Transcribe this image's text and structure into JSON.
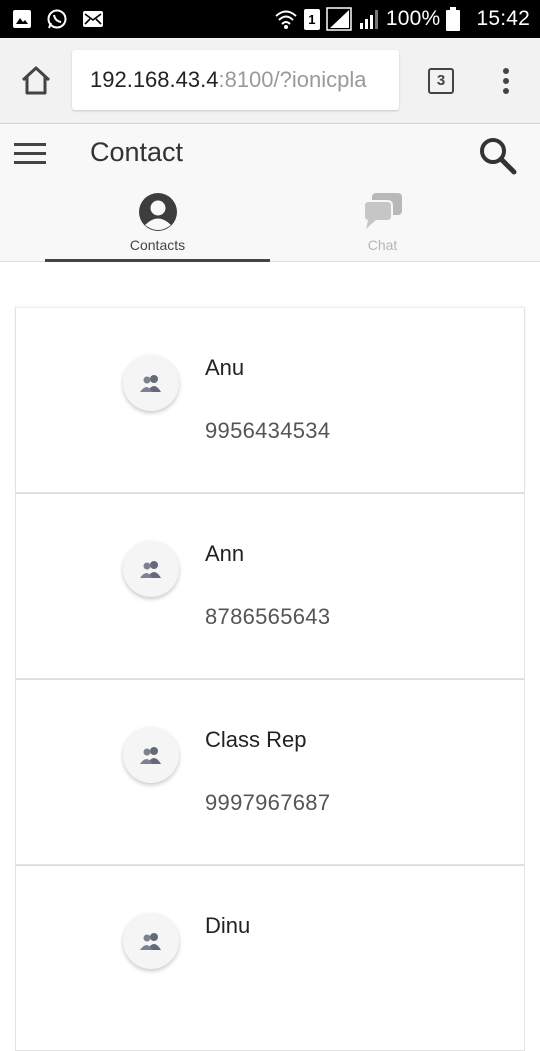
{
  "status_bar": {
    "battery": "100%",
    "time": "15:42",
    "sim_slot": "1"
  },
  "browser": {
    "url_host": "192.168.43.4",
    "url_rest": ":8100/?ionicpla",
    "tab_count": "3"
  },
  "header": {
    "title": "Contact"
  },
  "tabs": [
    {
      "label": "Contacts",
      "active": true,
      "icon": "person-icon"
    },
    {
      "label": "Chat",
      "active": false,
      "icon": "chat-bubbles-icon"
    }
  ],
  "contacts": [
    {
      "name": "Anu",
      "phone": "9956434534"
    },
    {
      "name": "Ann",
      "phone": "8786565643"
    },
    {
      "name": "Class Rep",
      "phone": "9997967687"
    },
    {
      "name": "Dinu",
      "phone": ""
    }
  ],
  "colors": {
    "active_tab": "#444444",
    "inactive_tab": "#b7b7b7",
    "header_bg": "#f8f8f8"
  }
}
